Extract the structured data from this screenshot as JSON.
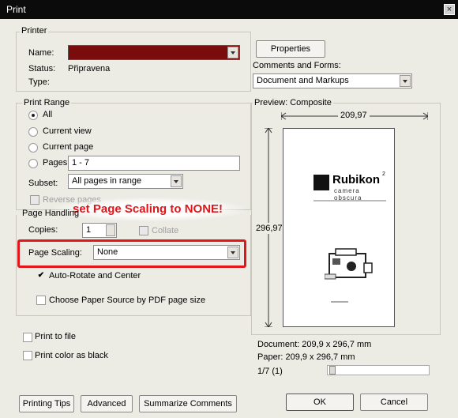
{
  "window": {
    "title": "Print",
    "close_glyph": "×"
  },
  "printer": {
    "legend": "Printer",
    "name_label": "Name:",
    "name_value": "",
    "status_label": "Status:",
    "status_value": "Připravena",
    "type_label": "Type:",
    "type_value": "",
    "properties_label": "Properties",
    "comments_forms_label": "Comments and Forms:",
    "comments_forms_value": "Document and Markups",
    "name_color": "#7a0c0c"
  },
  "print_range": {
    "legend": "Print Range",
    "all_label": "All",
    "current_view_label": "Current view",
    "current_page_label": "Current page",
    "pages_label": "Pages",
    "pages_value": "1 - 7",
    "subset_label": "Subset:",
    "subset_value": "All pages in range",
    "reverse_label": "Reverse pages"
  },
  "callout": {
    "text": "set Page Scaling to NONE!",
    "color": "#e0161b"
  },
  "page_handling": {
    "legend": "Page Handling",
    "copies_label": "Copies:",
    "copies_value": "1",
    "collate_label": "Collate",
    "scaling_label": "Page Scaling:",
    "scaling_value": "None",
    "auto_rotate_label": "Auto-Rotate and Center",
    "auto_rotate_checked": true,
    "paper_source_label": "Choose Paper Source by PDF page size"
  },
  "options": {
    "print_to_file_label": "Print to file",
    "print_color_black_label": "Print color as black"
  },
  "preview": {
    "legend": "Preview: Composite",
    "width_label": "209,97",
    "height_label": "296,97",
    "logo_text": "Rubikon",
    "logo_sup": "2",
    "logo_sub": "camera obscura",
    "document_size": "Document: 209,9 x 296,7 mm",
    "paper_size": "Paper: 209,9 x 296,7 mm",
    "page_counter": "1/7 (1)"
  },
  "buttons": {
    "printing_tips": "Printing Tips",
    "advanced": "Advanced",
    "summarize": "Summarize Comments",
    "ok": "OK",
    "cancel": "Cancel"
  }
}
